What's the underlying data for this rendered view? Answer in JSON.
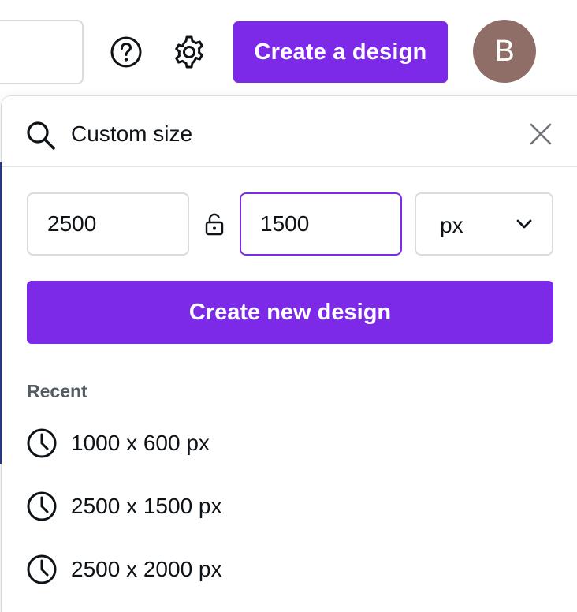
{
  "topbar": {
    "help_icon": "question-circle-icon",
    "settings_icon": "gear-icon",
    "create_design_label": "Create a design",
    "avatar_initial": "B",
    "avatar_color": "#8f6e68"
  },
  "panel": {
    "search_value": "Custom size",
    "width_value": "2500",
    "height_value": "1500",
    "unit_selected": "px",
    "create_new_label": "Create new design",
    "recent_heading": "Recent",
    "recent_items": [
      {
        "label": "1000 x 600 px"
      },
      {
        "label": "2500 x 1500 px"
      },
      {
        "label": "2500 x 2000 px"
      }
    ]
  },
  "colors": {
    "accent": "#7d2ae8",
    "text": "#0e1318",
    "muted": "#545b63",
    "border": "#d9dbdf"
  }
}
